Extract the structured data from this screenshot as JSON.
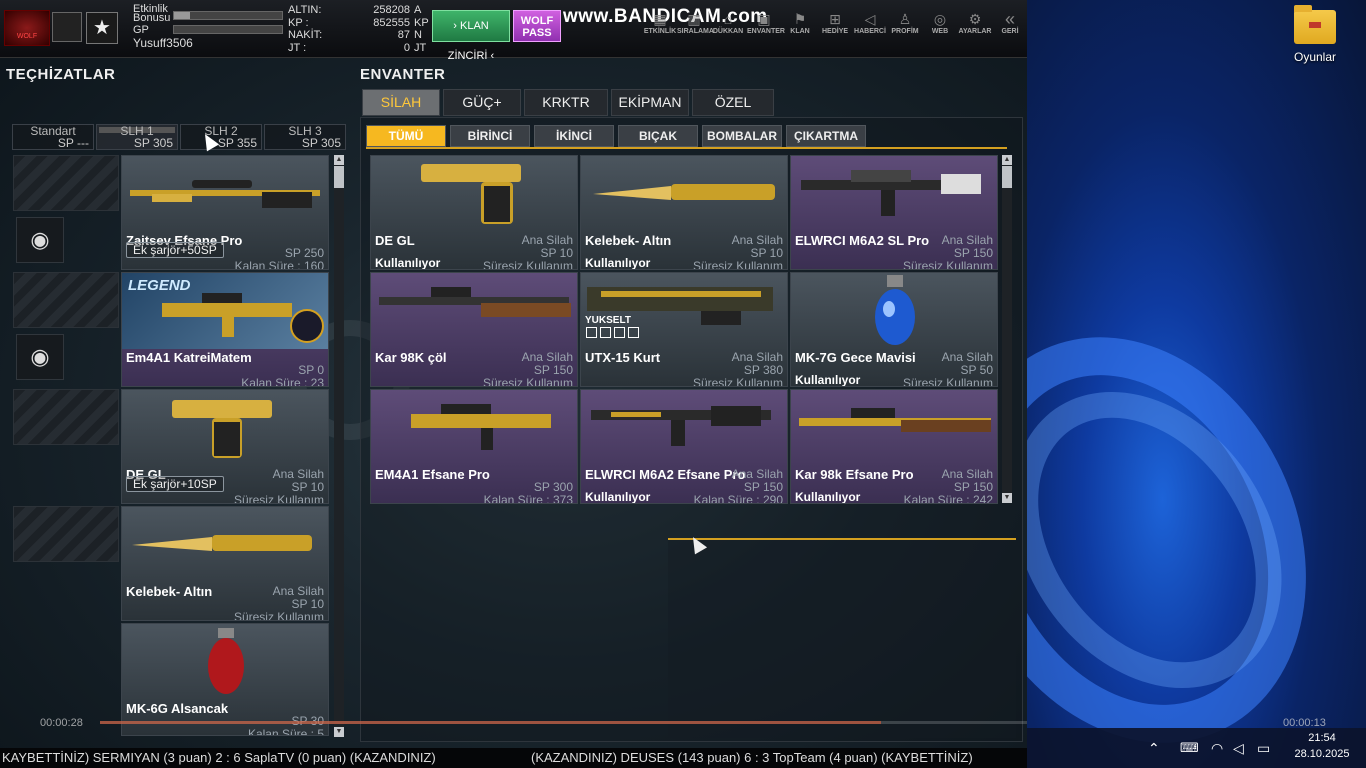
{
  "desktop": {
    "icon_label": "Oyunlar"
  },
  "tray": {
    "time": "21:54",
    "date": "28.10.2025"
  },
  "topbar": {
    "logo_text": "WOLF",
    "stats": {
      "etkinlik_label": "Etkinlik",
      "bonus_label": "Bonusu",
      "gp_label": "GP",
      "username": "Yusuff3506",
      "etkinlik_fill": 0.15,
      "gp_fill": 0
    },
    "money": [
      {
        "k": "ALTIN:",
        "v": "258208",
        "u": "A"
      },
      {
        "k": "KP :",
        "v": "852555",
        "u": "KP"
      },
      {
        "k": "NAKİT:",
        "v": "87",
        "u": "N"
      },
      {
        "k": "JT :",
        "v": "0",
        "u": "JT"
      }
    ],
    "clan_btn": "› KLAN ZİNCİRİ ‹",
    "wolf_btn": "WOLF PASS",
    "recorder_watermark": "www.BANDICAM.com",
    "nav": [
      {
        "label": "ETKİNLİK",
        "icon": "calendar-icon"
      },
      {
        "label": "SIRALAMA",
        "icon": "ranking-icon"
      },
      {
        "label": "DÜKKAN",
        "icon": "shop-icon"
      },
      {
        "label": "ENVANTER",
        "icon": "inventory-icon"
      },
      {
        "label": "KLAN",
        "icon": "clan-icon"
      },
      {
        "label": "HEDİYE",
        "icon": "gift-icon"
      },
      {
        "label": "HABERCİ",
        "icon": "megaphone-icon"
      },
      {
        "label": "PROFİM",
        "icon": "profile-icon"
      },
      {
        "label": "WEB",
        "icon": "globe-icon"
      },
      {
        "label": "AYARLAR",
        "icon": "gear-icon"
      },
      {
        "label": "GERİ",
        "icon": "back-icon"
      }
    ]
  },
  "left": {
    "title": "TEÇHİZATLAR",
    "slots": [
      {
        "name": "Standart",
        "sp": "SP ---"
      },
      {
        "name": "SLH 1",
        "sp": "SP 305"
      },
      {
        "name": "SLH 2",
        "sp": "SP 355"
      },
      {
        "name": "SLH 3",
        "sp": "SP 305"
      }
    ],
    "items": [
      {
        "name": "Zaitsev Efsane Pro",
        "ek": "Ek şarjör+50SP",
        "sp": "SP 250",
        "dur": "Kalan Süre : 160"
      },
      {
        "name": "Em4A1 KatreiMatem",
        "sp": "SP 0",
        "dur": "Kalan Süre : 23",
        "legend": "LEGEND"
      },
      {
        "name": "DE GL",
        "type": "Ana Silah",
        "ek": "Ek şarjör+10SP",
        "sp": "SP 10",
        "dur": "Süresiz Kullanım"
      },
      {
        "name": "Kelebek- Altın",
        "type": "Ana Silah",
        "sp": "SP 10",
        "dur": "Süresiz Kullanım"
      },
      {
        "name": "MK-6G Alsancak",
        "sp": "SP 30",
        "dur": "Kalan Süre : 5"
      }
    ]
  },
  "inventory": {
    "title": "ENVANTER",
    "tabs": [
      "SİLAH",
      "GÜÇ+",
      "KRKTR",
      "EKİPMAN",
      "ÖZEL"
    ],
    "subtabs": [
      "TÜMÜ",
      "BİRİNCİ",
      "İKİNCİ",
      "BIÇAK",
      "BOMBALAR",
      "ÇIKARTMA"
    ],
    "items": [
      {
        "name": "DE GL",
        "type": "Ana Silah",
        "sp": "SP 10",
        "used": "Kullanılıyor",
        "dur": "Süresiz Kullanım"
      },
      {
        "name": "Kelebek- Altın",
        "type": "Ana Silah",
        "sp": "SP 10",
        "used": "Kullanılıyor",
        "dur": "Süresiz Kullanım"
      },
      {
        "name": "ELWRCI M6A2 SL Pro",
        "type": "Ana Silah",
        "sp": "SP 150",
        "dur": "Süresiz Kullanım"
      },
      {
        "name": "Kar 98K çöl",
        "type": "Ana Silah",
        "sp": "SP 150",
        "dur": "Süresiz Kullanım"
      },
      {
        "name": "UTX-15 Kurt",
        "type": "Ana Silah",
        "sp": "SP 380",
        "dur": "Süresiz Kullanım",
        "upgrade": "YUKSELT"
      },
      {
        "name": "MK-7G Gece Mavisi",
        "type": "Ana Silah",
        "sp": "SP 50",
        "used": "Kullanılıyor",
        "dur": "Süresiz Kullanım"
      },
      {
        "name": "EM4A1 Efsane Pro",
        "sp": "SP 300",
        "dur": "Kalan Süre : 373"
      },
      {
        "name": "ELWRCI M6A2 Efsane Pro",
        "type": "Ana Silah",
        "sp": "SP 150",
        "used": "Kullanılıyor",
        "dur": "Kalan Süre : 290"
      },
      {
        "name": "Kar 98k Efsane Pro",
        "type": "Ana Silah",
        "sp": "SP 150",
        "used": "Kullanılıyor",
        "dur": "Kalan Süre : 242"
      }
    ]
  },
  "player": {
    "elapsed": "00:00:28",
    "total": "00:00:13",
    "progress": 0.67
  },
  "ticker": {
    "left": "KAYBETTİNİZ) SERMIYAN (3 puan) 2 : 6 SaplaTV (0 puan) (KAZANDINIZ)",
    "right": "(KAZANDINIZ) DEUSES (143 puan) 6 : 3 TopTeam (4 puan) (KAYBETTİNİZ)"
  }
}
